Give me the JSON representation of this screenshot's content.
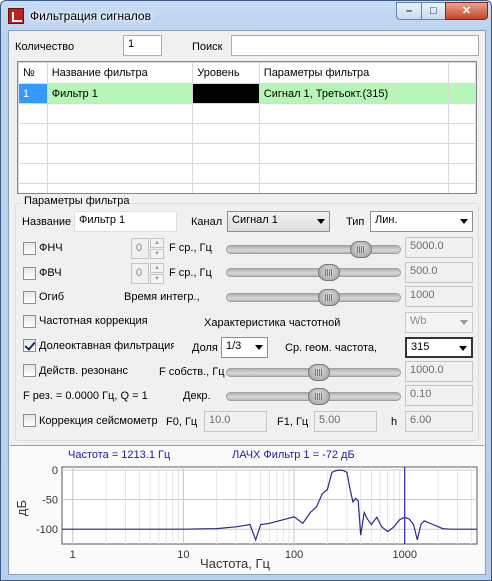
{
  "window": {
    "title": "Фильтрация сигналов",
    "buttons": {
      "min": "–",
      "max": "□",
      "close": "✕"
    }
  },
  "top": {
    "count_label": "Количество",
    "count_value": "1",
    "search_label": "Поиск",
    "search_value": ""
  },
  "table": {
    "columns": [
      "№",
      "Название фильтра",
      "Уровень",
      "Параметры фильтра"
    ],
    "rows": [
      {
        "num": "1",
        "name": "Фильтр 1",
        "level_color": "#000000",
        "params": "Сигнал 1, Третьокт.(315)"
      }
    ]
  },
  "params": {
    "group_title": "Параметры фильтра",
    "name_label": "Название",
    "name_value": "Фильтр 1",
    "channel_label": "Канал",
    "channel_value": "Сигнал 1",
    "type_label": "Тип",
    "type_value": "Лин.",
    "lpf": {
      "label": "ФНЧ",
      "checked": false,
      "spin": "0",
      "freq_label": "F ср., Гц",
      "level": 0.77,
      "value": "5000.0"
    },
    "hpf": {
      "label": "ФВЧ",
      "checked": false,
      "spin": "0",
      "freq_label": "F ср., Гц",
      "level": 0.59,
      "value": "500.0"
    },
    "env": {
      "label": "Огиб",
      "checked": false,
      "time_label": "Время интегр.,",
      "level": 0.59,
      "value": "1000"
    },
    "freq_corr": {
      "label": "Частотная коррекция",
      "checked": false,
      "char_label": "Характеристика частотной",
      "char_value": "Wb"
    },
    "oct": {
      "label": "Долеоктавная фильтрация",
      "checked": true,
      "share_label": "Доля",
      "share_value": "1/3",
      "geo_label": "Ср. геом. частота,",
      "geo_value": "315"
    },
    "res": {
      "label": "Действ. резонанс",
      "checked": false,
      "freq_label": "F собств., Гц",
      "level": 0.53,
      "value": "1000.0"
    },
    "res_info": {
      "text": "F рез. = 0.0000 Гц, Q = 1",
      "decr_label": "Декр.",
      "level": 0.53,
      "value": "0.10"
    },
    "seismo": {
      "label": "Коррекция сейсмометра",
      "checked": false,
      "f0_label": "F0, Гц",
      "f0_value": "10.0",
      "f1_label": "F1, Гц",
      "f1_value": "5.00",
      "h_label": "h",
      "h_value": "6.00"
    }
  },
  "chart_data": {
    "type": "line",
    "title": "",
    "header_left": "Частота = 1213.1 Гц",
    "header_right": "ЛАЧХ Фильтр 1 = -72 дБ",
    "xlabel": "Частота, Гц",
    "ylabel": "дБ",
    "xscale": "log",
    "xlim": [
      0.8,
      4500
    ],
    "ylim": [
      -125,
      5
    ],
    "xticks": [
      "1",
      "10",
      "100",
      "1000"
    ],
    "yticks": [
      "0",
      "-50",
      "-100"
    ],
    "grid": true,
    "cursor_x": 1000,
    "series": [
      {
        "x": [
          0.8,
          3,
          10,
          20,
          30,
          40,
          45,
          50,
          60,
          80,
          100,
          120,
          140,
          160,
          180,
          200,
          220,
          240,
          260,
          280,
          300,
          320,
          340,
          360,
          380,
          400,
          430,
          460,
          500,
          560,
          620,
          700,
          800,
          900,
          1000,
          1100,
          1200,
          1300,
          1400,
          1500,
          1800,
          2200,
          2600,
          3000,
          3500,
          4500
        ],
        "y": [
          -100,
          -100,
          -100,
          -99,
          -96,
          -92,
          -118,
          -92,
          -90,
          -84,
          -79,
          -90,
          -72,
          -62,
          -40,
          -33,
          -4,
          -1,
          0,
          -1,
          -4,
          -32,
          -54,
          -48,
          -52,
          -110,
          -72,
          -83,
          -92,
          -80,
          -96,
          -104,
          -96,
          -84,
          -80,
          -83,
          -92,
          -118,
          -92,
          -86,
          -92,
          -99,
          -100,
          -100,
          -100,
          -100
        ]
      }
    ]
  },
  "colors": {
    "row_highlight": "#b8f5b8",
    "row_number_bg": "#3399ff",
    "curve": "#2a2a86",
    "cursor": "#2a2ab0",
    "header_text": "#1e1e9e"
  }
}
